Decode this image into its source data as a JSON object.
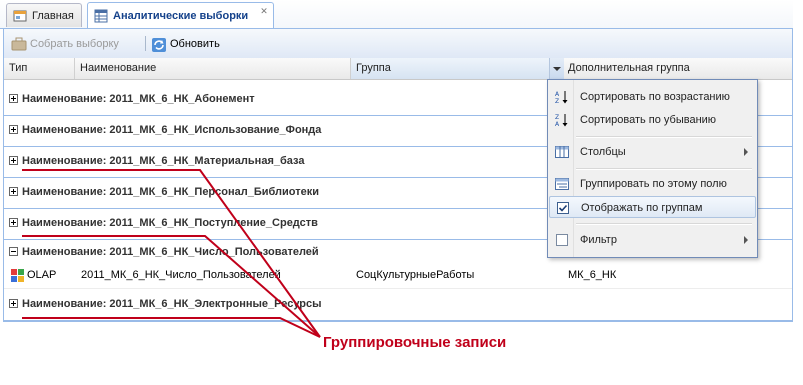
{
  "tabs": [
    {
      "label": "Главная",
      "icon": "home-tab-icon"
    },
    {
      "label": "Аналитические выборки",
      "icon": "table-tab-icon",
      "active": true
    }
  ],
  "toolbar": {
    "collect_label": "Собрать выборку",
    "refresh_label": "Обновить"
  },
  "columns": [
    "Тип",
    "Наименование",
    "Группа",
    "Дополнительная группа"
  ],
  "group_rows": [
    {
      "label": "Наименование: 2011_МК_6_НК_Абонемент",
      "expanded": false
    },
    {
      "label": "Наименование: 2011_МК_6_НК_Использование_Фонда",
      "expanded": false
    },
    {
      "label": "Наименование: 2011_МК_6_НК_Материальная_база",
      "expanded": false
    },
    {
      "label": "Наименование: 2011_МК_6_НК_Персонал_Библиотеки",
      "expanded": false
    },
    {
      "label": "Наименование: 2011_МК_6_НК_Поступление_Средств",
      "expanded": false
    },
    {
      "label": "Наименование: 2011_МК_6_НК_Число_Пользователей",
      "expanded": true
    },
    {
      "label": "Наименование: 2011_МК_6_НК_Электронные_Ресурсы",
      "expanded": false
    }
  ],
  "data_row": {
    "type": "OLAP",
    "name": "2011_МК_6_НК_Число_Пользователей",
    "group": "СоцКультурныеРаботы",
    "extra_group": "МК_6_НК"
  },
  "menu": {
    "sort_asc": "Сортировать по возрастанию",
    "sort_desc": "Сортировать по убыванию",
    "columns": "Столбцы",
    "group_by": "Группировать по этому полю",
    "show_groups": "Отображать по группам",
    "show_groups_checked": true,
    "filter": "Фильтр",
    "filter_checked": false
  },
  "annotation": "Группировочные записи",
  "colors": {
    "accent": "#15428b",
    "border": "#99bbe8",
    "annotation": "#c0001a"
  }
}
